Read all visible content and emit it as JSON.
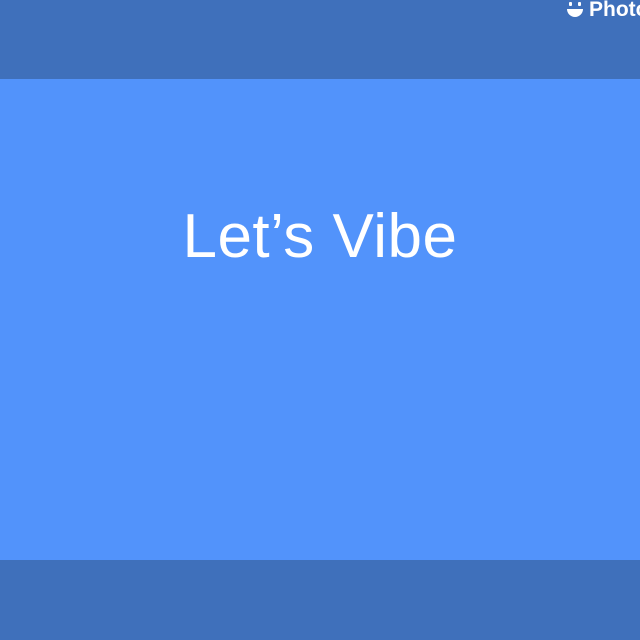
{
  "watermark": {
    "text": "Photo",
    "icon": "smiley-icon"
  },
  "slide": {
    "title": "Let’s Vibe"
  },
  "colors": {
    "frame": "#3f70bb",
    "slide_background": "#5293fb",
    "text": "#ffffff"
  }
}
